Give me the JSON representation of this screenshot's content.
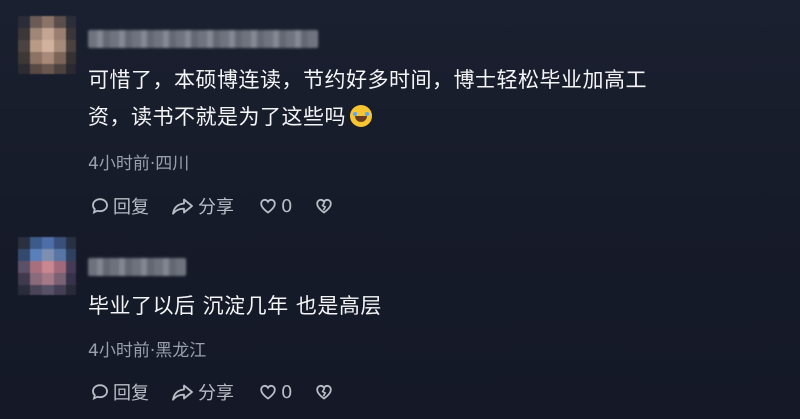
{
  "comments": [
    {
      "text_line1": "可惜了，本硕博连读，节约好多时间，博士轻松毕业加高工",
      "text_line2": "资，读书不就是为了这些吗",
      "emoji": "rolling-laughing-emoji",
      "meta": "4小时前·四川",
      "reply_label": "回复",
      "share_label": "分享",
      "like_count": "0"
    },
    {
      "text": "毕业了以后 沉淀几年 也是高层",
      "meta": "4小时前·黑龙江",
      "reply_label": "回复",
      "share_label": "分享",
      "like_count": "0"
    }
  ],
  "colors": {
    "background": "#161b29",
    "text": "#f4f5f7",
    "muted": "#9aa0ab",
    "action": "#b8bdc6"
  }
}
